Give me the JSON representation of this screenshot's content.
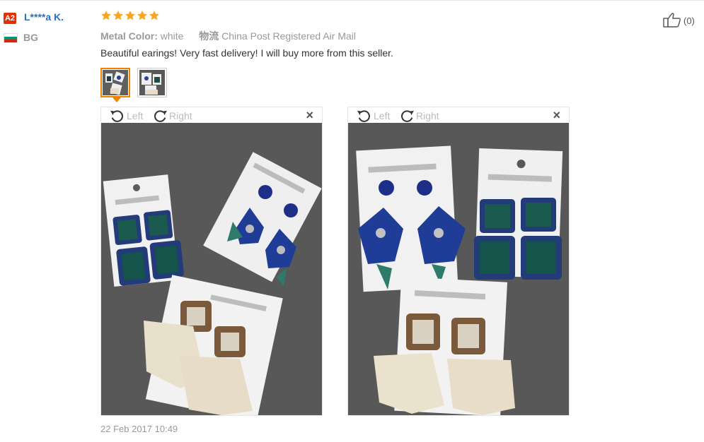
{
  "reviewer": {
    "badge": "A2",
    "name": "L****a K.",
    "country_code": "BG"
  },
  "rating": {
    "stars": 5,
    "star_color": "#f5a623"
  },
  "order_info": {
    "color_label": "Metal Color:",
    "color_value": "white",
    "shipping_label": "物流",
    "shipping_value": "China Post Registered Air Mail"
  },
  "review": {
    "text": "Beautiful earings! Very fast delivery! I will buy more from this seller.",
    "date": "22 Feb 2017 10:49"
  },
  "helpful": {
    "count": "(0)",
    "icon": "thumbs-up-icon"
  },
  "viewer": {
    "rotate_left_label": "Left",
    "rotate_right_label": "Right",
    "close_symbol": "×"
  },
  "colors": {
    "accent": "#f08200",
    "link_blue": "#2a6fc7",
    "badge_red": "#e62e04"
  }
}
